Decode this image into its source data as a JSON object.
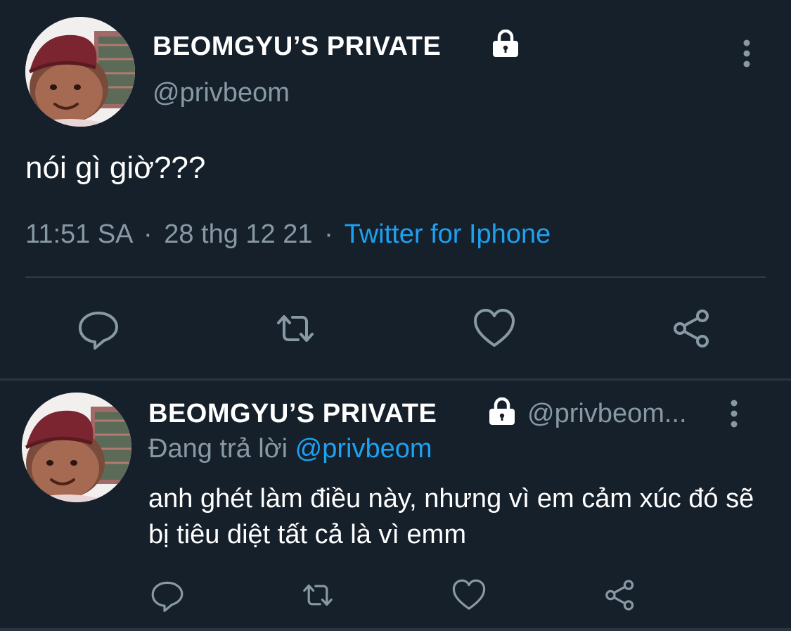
{
  "tweet": {
    "display_name": "BEOMGYU’S PRIVATE",
    "handle": "@privbeom",
    "text": "nói gì giờ???",
    "time": "11:51 SA",
    "date": "28 thg 12 21",
    "separator": "·",
    "source": "Twitter for Iphone",
    "avatar_icon": "baby-photo-avatar",
    "lock_icon": "lock-icon",
    "more_icon": "more-vertical-icon",
    "actions": [
      {
        "name": "reply",
        "icon": "reply-icon"
      },
      {
        "name": "retweet",
        "icon": "retweet-icon"
      },
      {
        "name": "like",
        "icon": "heart-icon"
      },
      {
        "name": "share",
        "icon": "share-icon"
      }
    ]
  },
  "reply": {
    "display_name": "BEOMGYU’S PRIVATE",
    "handle": "@privbeom...",
    "replying_label": "Đang trả lời",
    "replying_to": "@privbeom",
    "text": "anh ghét làm điều này, nhưng vì em cảm xúc đó sẽ bị tiêu diệt tất cả là vì emm"
  },
  "colors": {
    "background": "#16202b",
    "text": "#ffffff",
    "secondary_text": "#8899a6",
    "link": "#1da1f2",
    "divider": "#2f3b47"
  }
}
